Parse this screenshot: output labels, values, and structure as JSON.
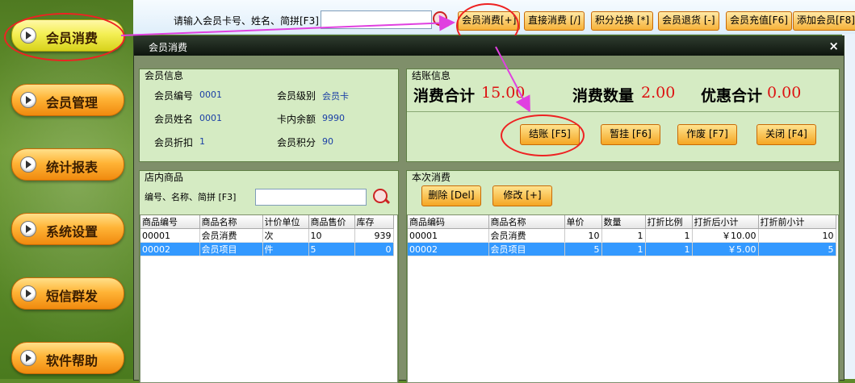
{
  "sidebar": {
    "items": [
      {
        "label": "会员消费"
      },
      {
        "label": "会员管理"
      },
      {
        "label": "统计报表"
      },
      {
        "label": "系统设置"
      },
      {
        "label": "短信群发"
      },
      {
        "label": "软件帮助"
      }
    ]
  },
  "topbar": {
    "search_label": "请输入会员卡号、姓名、简拼[F3]",
    "search_value": "",
    "buttons": [
      {
        "label": "会员消费[+]"
      },
      {
        "label": "直接消费 [/]"
      },
      {
        "label": "积分兑换 [*]"
      },
      {
        "label": "会员退货 [-]"
      },
      {
        "label": "会员充值[F6]"
      },
      {
        "label": "添加会员[F8]"
      }
    ]
  },
  "dialog": {
    "title": "会员消费",
    "close": "×",
    "member_info": {
      "legend": "会员信息",
      "fields": [
        {
          "k": "会员编号",
          "v": "0001"
        },
        {
          "k": "会员级别",
          "v": "会员卡"
        },
        {
          "k": "会员姓名",
          "v": "0001"
        },
        {
          "k": "卡内余额",
          "v": "9990"
        },
        {
          "k": "会员折扣",
          "v": "1"
        },
        {
          "k": "会员积分",
          "v": "90"
        }
      ]
    },
    "checkout": {
      "legend": "结账信息",
      "total_label": "消费合计",
      "total_value": "15.00",
      "qty_label": "消费数量",
      "qty_value": "2.00",
      "discount_label": "优惠合计",
      "discount_value": "0.00",
      "buttons": {
        "pay": "结账 [F5]",
        "hold": "暂挂 [F6]",
        "void": "作废 [F7]",
        "close": "关闭 [F4]"
      }
    },
    "store_goods": {
      "legend": "店内商品",
      "search_label": "编号、名称、简拼 [F3]",
      "search_value": "",
      "columns": [
        "商品编号",
        "商品名称",
        "计价单位",
        "商品售价",
        "库存"
      ],
      "rows": [
        {
          "code": "00001",
          "name": "会员消费",
          "unit": "次",
          "price": "10",
          "stock": "939"
        },
        {
          "code": "00002",
          "name": "会员项目",
          "unit": "件",
          "price": "5",
          "stock": "0"
        }
      ]
    },
    "current": {
      "legend": "本次消费",
      "delete_label": "删除 [Del]",
      "edit_label": "修改 [+]",
      "columns": [
        "商品编码",
        "商品名称",
        "单价",
        "数量",
        "打折比例",
        "打折后小计",
        "打折前小计"
      ],
      "rows": [
        {
          "code": "00001",
          "name": "会员消费",
          "price": "10",
          "qty": "1",
          "ratio": "1",
          "after": "￥10.00",
          "before": "10"
        },
        {
          "code": "00002",
          "name": "会员项目",
          "price": "5",
          "qty": "1",
          "ratio": "1",
          "after": "￥5.00",
          "before": "5"
        }
      ]
    }
  }
}
